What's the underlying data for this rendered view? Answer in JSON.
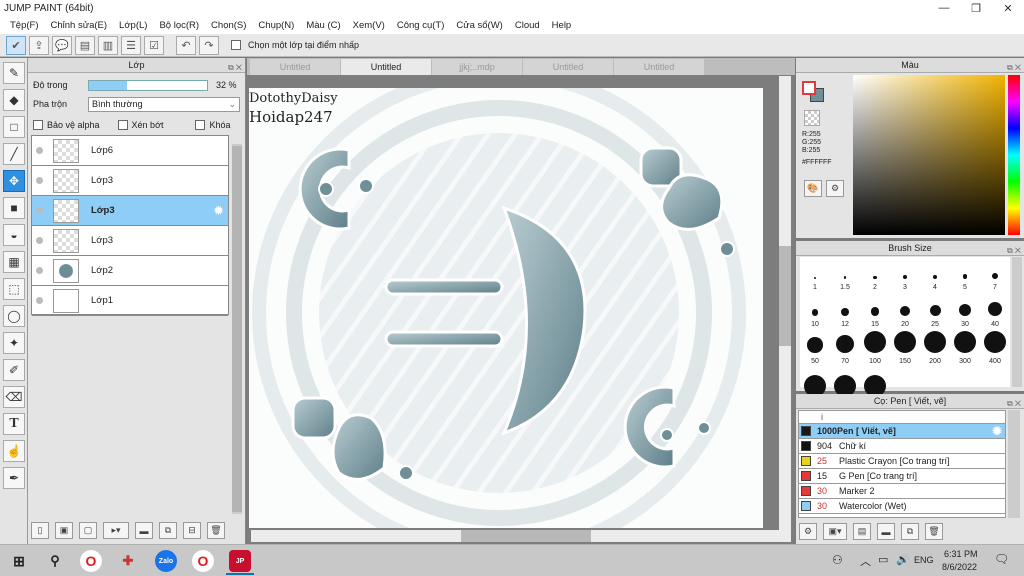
{
  "window": {
    "title": "JUMP PAINT (64bit)"
  },
  "menu": [
    "Tệp(F)",
    "Chỉnh sửa(E)",
    "Lớp(L)",
    "Bộ lọc(R)",
    "Chọn(S)",
    "Chụp(N)",
    "Màu (C)",
    "Xem(V)",
    "Công cụ(T)",
    "Cửa sổ(W)",
    "Cloud",
    "Help"
  ],
  "toolbar": {
    "select_layer_label": "Chọn một lớp tại điểm nhấp"
  },
  "layer_panel": {
    "title": "Lớp",
    "opacity_label": "Độ trong",
    "opacity_value": "32 %",
    "opacity_fraction": 0.32,
    "blend_label": "Pha trộn",
    "blend_value": "Bình thường",
    "protect_alpha": "Bảo vệ alpha",
    "clipping": "Xén bớt",
    "lock": "Khóa",
    "layers": [
      {
        "name": "Lớp6",
        "selected": false
      },
      {
        "name": "Lớp3",
        "selected": false
      },
      {
        "name": "Lớp3",
        "selected": true
      },
      {
        "name": "Lớp3",
        "selected": false
      },
      {
        "name": "Lớp2",
        "selected": false
      },
      {
        "name": "Lớp1",
        "selected": false
      }
    ]
  },
  "tabs": [
    "Untitled",
    "Untitled",
    "jjkj;..mdp",
    "Untitled",
    "Untitled"
  ],
  "active_tab": 1,
  "canvas": {
    "watermark_line1": "DotothyDaisy",
    "watermark_line2": "Hoidap247"
  },
  "color_panel": {
    "title": "Màu",
    "r": "R:255",
    "g": "G:255",
    "b": "B:255",
    "hex": "#FFFFFF",
    "accent_top": "#e23a3a",
    "accent_bottom": "#6f8f98"
  },
  "brush_panel": {
    "title": "Brush Size",
    "sizes": [
      "1",
      "1.5",
      "2",
      "3",
      "4",
      "5",
      "7",
      "10",
      "12",
      "15",
      "20",
      "25",
      "30",
      "40",
      "50",
      "70",
      "100",
      "150",
      "200",
      "300",
      "400",
      "",
      "",
      ""
    ]
  },
  "pen_panel": {
    "title": "Cọ: Pen [ Viết, vẽ]",
    "header": "i",
    "items": [
      {
        "num": "",
        "name": "1000Pen [ Viết, vẽ]",
        "color": "#1a1a1a",
        "selected": true
      },
      {
        "num": "904",
        "name": "Chữ kí",
        "color": "#111111",
        "selected": false
      },
      {
        "num": "25",
        "name": "Plastic Crayon [Co trang trí]",
        "color": "#e8d21c",
        "selected": false
      },
      {
        "num": "15",
        "name": "G Pen [Co trang trí]",
        "color": "#e23a3a",
        "selected": false
      },
      {
        "num": "30",
        "name": "Marker 2",
        "color": "#e23a3a",
        "selected": false
      },
      {
        "num": "30",
        "name": "Watercolor (Wet)",
        "color": "#8ecdf5",
        "selected": false
      }
    ]
  },
  "taskbar": {
    "lang": "ENG",
    "time": "6:31 PM",
    "date": "8/6/2022",
    "zalo_label": "Zalo"
  }
}
